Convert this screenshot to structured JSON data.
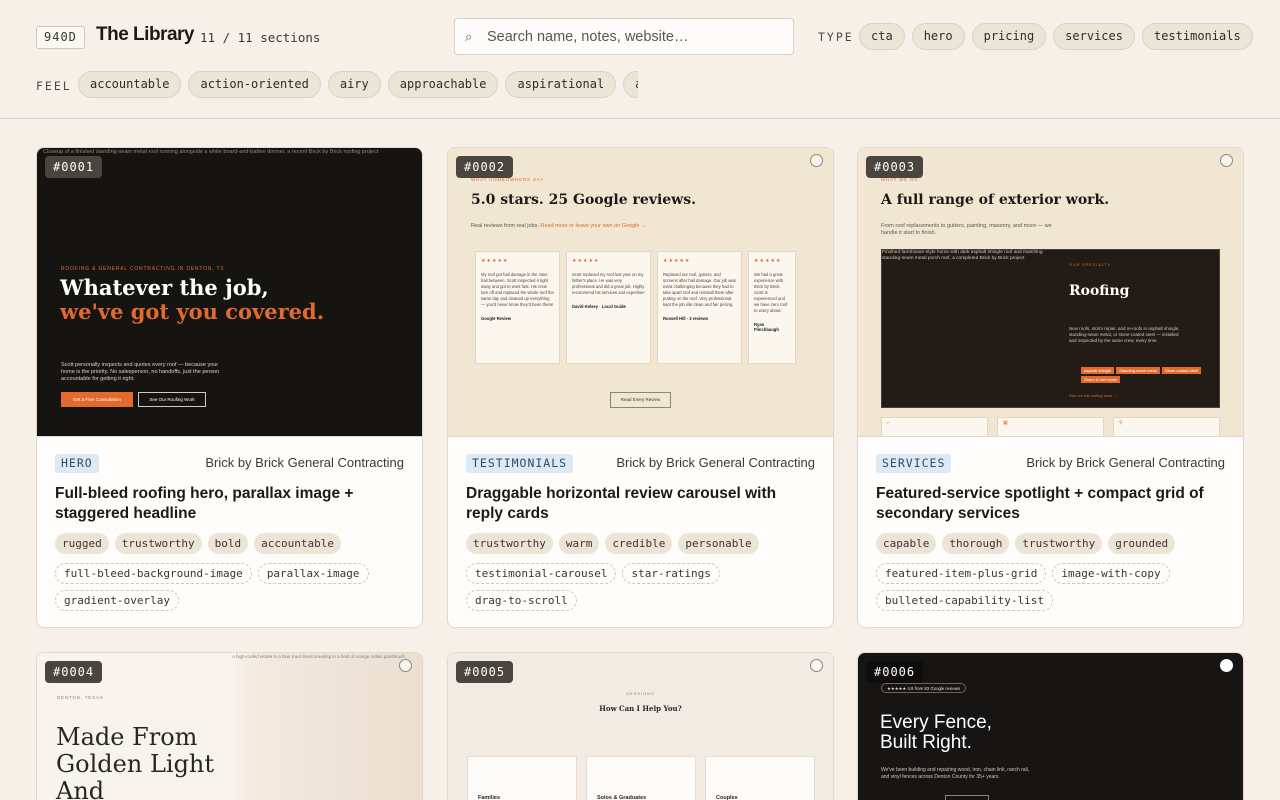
{
  "header": {
    "logo_badge": "940D",
    "title": "The Library",
    "count": "11 / 11 sections",
    "search_placeholder": "Search name, notes, website…",
    "type_label": "TYPE",
    "type_chips": [
      "cta",
      "hero",
      "pricing",
      "services",
      "testimonials"
    ],
    "feel_label": "FEEL",
    "feel_chips": [
      "accountable",
      "action-oriented",
      "airy",
      "approachable",
      "aspirational",
      "au"
    ]
  },
  "colors": {
    "accent": "#e26a2c",
    "background": "#f6f0e9"
  },
  "cards": [
    {
      "num": "#0001",
      "category": "HERO",
      "client": "Brick by Brick General Contracting",
      "title": "Full-bleed roofing hero, parallax image + staggered headline",
      "feel_tags": [
        "rugged",
        "trustworthy",
        "bold",
        "accountable"
      ],
      "pattern_tags": [
        "full-bleed-background-image",
        "parallax-image",
        "gradient-overlay"
      ],
      "preview": {
        "alt": "Closeup of a finished standing-seam metal roof running alongside a white board-and-batten dormer, a recent Brick by Brick roofing project",
        "eyebrow": "ROOFING & GENERAL CONTRACTING IN DENTON, TX",
        "headline_1": "Whatever the job,",
        "headline_2": "we've got you covered.",
        "sub": "Scott personally inspects and quotes every roof — because your home is the priority. No salesperson, no handoffs, just the person accountable for getting it right.",
        "btn_primary": "Get a Free Consultation",
        "btn_secondary": "See Our Roofing Work"
      }
    },
    {
      "num": "#0002",
      "category": "TESTIMONIALS",
      "client": "Brick by Brick General Contracting",
      "title": "Draggable horizontal review carousel with reply cards",
      "feel_tags": [
        "trustworthy",
        "warm",
        "credible",
        "personable"
      ],
      "pattern_tags": [
        "testimonial-carousel",
        "star-ratings",
        "drag-to-scroll"
      ],
      "preview": {
        "eyebrow": "WHAT HOMEOWNERS SAY",
        "headline": "5.0 stars. 25 Google reviews.",
        "sub": "Real reviews from real jobs.",
        "sub_link": "Read more or leave your own on Google →",
        "reviews": [
          {
            "stars": "★★★★★",
            "text": "My roof got hail damage in the June hail between. Scott inspected it right away and got to work fast. His crew tore off and replaced the whole roof the same day and cleaned up everything — you'd never know they'd been there!",
            "who": "Google Review"
          },
          {
            "stars": "★★★★★",
            "text": "Scott replaced my roof last year on my father's place. He was very professional and did a great job. Highly recommend his services and expertise!",
            "who": "David Kelsey · Local Guide"
          },
          {
            "stars": "★★★★★",
            "text": "Replaced our roof, gutters, and screens after hail damage. Our job was extra challenging because they had to take apart roof and reinstall them after putting on the roof. Very professional, kept the job site clean and fair pricing.",
            "who": "Russell Hill · 3 reviews"
          },
          {
            "stars": "★★★★★",
            "text": "We had a great experience with Brick by Brick. Scott is experienced and we have zero roof to worry about.",
            "who": "Ryan Flinchbaugh"
          }
        ],
        "button": "Read Every Review"
      }
    },
    {
      "num": "#0003",
      "category": "SERVICES",
      "client": "Brick by Brick General Contracting",
      "title": "Featured-service spotlight + compact grid of secondary services",
      "feel_tags": [
        "capable",
        "thorough",
        "trustworthy",
        "grounded"
      ],
      "pattern_tags": [
        "featured-item-plus-grid",
        "image-with-copy",
        "bulleted-capability-list"
      ],
      "preview": {
        "eyebrow": "WHAT WE DO",
        "headline": "A full range of exterior work.",
        "sub": "From roof replacements to gutters, painting, masonry, and more — we handle it start to finish.",
        "spot_alt": "Finished farmhouse-style home with dark asphalt shingle roof and matching standing-seam metal porch roof, a completed Brick by Brick project",
        "spot_eyebrow": "OUR SPECIALTY",
        "spot_title": "Roofing",
        "spot_sub": "New roofs, storm repair, and re-roofs in asphalt shingle, standing-seam metal, or stone coated steel — installed and inspected by the same crew, every time.",
        "spot_chips": [
          "Asphalt shingle",
          "Standing-seam metal",
          "Stone coated steel",
          "Storm & hail repair"
        ],
        "spot_link": "See our full roofing work →",
        "mini_icons": [
          "⌐",
          "▦",
          "⚲"
        ]
      }
    },
    {
      "num": "#0004",
      "preview": {
        "eyebrow": "DENTON, TEXAS",
        "alt": "A high-roofed estate in a blue Kaul dress kneeling in a field of orange indian paintbrush",
        "headline": "Made From Golden Light And"
      }
    },
    {
      "num": "#0005",
      "preview": {
        "eyebrow": "SESSIONS",
        "headline": "How Can I Help You?",
        "boxes": [
          "Families",
          "Solos & Graduates",
          "Couples"
        ]
      }
    },
    {
      "num": "#0006",
      "preview": {
        "stars": "★★★★★ 4.9 from 83 Google reviews",
        "headline_1": "Every Fence,",
        "headline_2": "Built Right.",
        "sub": "We've been building and repairing wood, iron, chain link, ranch rail, and vinyl fences across Denton County for 35+ years."
      }
    }
  ]
}
